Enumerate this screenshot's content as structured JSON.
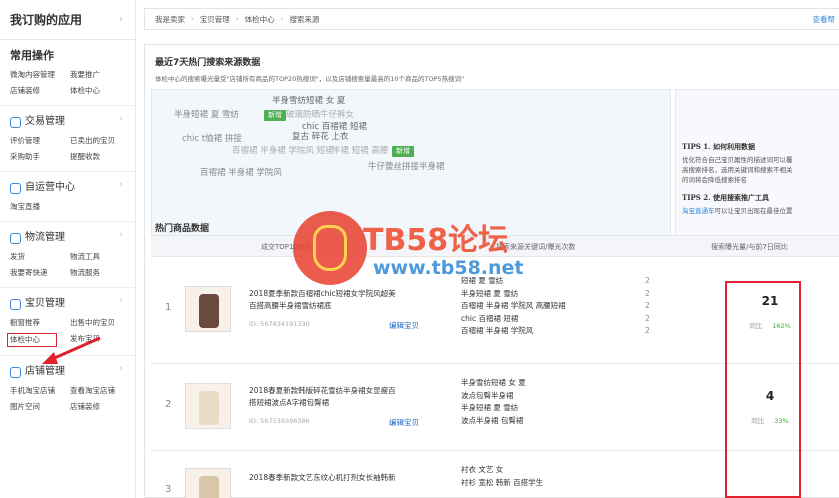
{
  "sidebar": {
    "title": "我订购的应用",
    "common_title": "常用操作",
    "common_links": [
      "微淘内容管理",
      "我要推广",
      "店铺装修",
      "体检中心"
    ],
    "groups": [
      {
        "name": "交易管理",
        "icon": "yen-icon",
        "links": [
          "评价管理",
          "已卖出的宝贝",
          "采购助手",
          "提醒收款"
        ]
      },
      {
        "name": "自运营中心",
        "icon": "chat-icon",
        "links": [
          "淘宝直播"
        ]
      },
      {
        "name": "物流管理",
        "icon": "truck-icon",
        "links": [
          "发货",
          "物流工具",
          "我要寄快递",
          "物流服务"
        ]
      },
      {
        "name": "宝贝管理",
        "icon": "bag-icon",
        "links": [
          "橱窗推荐",
          "出售中的宝贝",
          "体检中心",
          "发布宝贝"
        ]
      },
      {
        "name": "店铺管理",
        "icon": "shop-icon",
        "links": [
          "手机淘宝店铺",
          "查看淘宝店铺",
          "图片空间",
          "店铺装修"
        ]
      }
    ]
  },
  "breadcrumb": [
    "我是卖家",
    "宝贝管理",
    "体检中心",
    "搜索来源"
  ],
  "top_right": "查看帮",
  "section1": {
    "title": "最近7天热门搜索来源数据",
    "desc": "体检中心的搜索曝光量受\"店铺所有商品的TOP20热搜词\"，以及店铺搜索量最高的10个商品的TOP5热搜词\""
  },
  "word_cloud": {
    "words": [
      "半身雪纺短裙 女 夏",
      "半身短裙 夏 雪纺",
      "玻璃防晒牛仔裤女",
      "chic 百褶裙 短裙",
      "chic t恤裙 拼接",
      "复古 碎花 上衣",
      "百褶裙 半身裙 学院风 短裙",
      "半裙 短裙 高腰",
      "百褶裙 半身裙 学院风",
      "牛仔蕾丝拼接半身裙"
    ],
    "tags": [
      "新增",
      "新增"
    ]
  },
  "tips": {
    "tip1_title": "TIPS 1. 如何利用数据",
    "tip1_lines": [
      "优化符合自己宝贝属性的描述词可以覆",
      "高搜索排名，选用关键词和搜索不相关",
      "的词将会降低搜索排名"
    ],
    "tip2_title": "TIPS 2. 使用搜索推广工具",
    "tip2_link": "淘宝直通车",
    "tip2_rest": "可以让宝贝出现在最佳位置"
  },
  "section2": {
    "title": "热门商品数据"
  },
  "table": {
    "headers": [
      "成交TOP10宝贝",
      "搜索来源关键词/曝光次数",
      "搜索曝光量/与前7日同比"
    ],
    "rows": [
      {
        "rank": "1",
        "name1": "2018夏季新款百褶裙chic短裙女学院风超美",
        "name2": "百搭高腰半身裙雪纺裙底",
        "id": "ID: 567834191330",
        "edit": "编辑宝贝",
        "keywords": [
          "短裙 夏 雪纺",
          "半身短裙 夏 雪纺",
          "百褶裙 半身裙 学院风 高腰短裙",
          "chic 百褶裙 短裙",
          "百褶裙 半身裙 学院风"
        ],
        "counts": [
          "2",
          "2",
          "2",
          "2",
          "2"
        ],
        "exposure": "21",
        "compare_label": "同比",
        "compare_value": "162%"
      },
      {
        "rank": "2",
        "name1": "2018春夏新款韩版碎花雪纺半身裙女显瘦百",
        "name2": "搭短裙波点A字裙包臀裙",
        "id": "ID: 567539396386",
        "edit": "编辑宝贝",
        "keywords": [
          "半身雪纺短裙 女 夏",
          "波点包臀半身裙",
          "半身短裙 夏 雪纺",
          "波点半身裙 包臀裙"
        ],
        "counts": [
          "",
          "",
          "",
          ""
        ],
        "exposure": "4",
        "compare_label": "同比",
        "compare_value": "33%"
      },
      {
        "rank": "3",
        "name1": "2018春季新款文艺东纹心机打剂女长袖韩新",
        "name2": "",
        "id": "",
        "edit": "",
        "keywords": [
          "衬衣 文艺 女",
          "衬衫 宽松 韩新 百搭学生"
        ],
        "counts": [],
        "exposure": "",
        "compare_label": "",
        "compare_value": ""
      }
    ]
  },
  "watermark": {
    "title": "TB58论坛",
    "url": "www.tb58.net"
  },
  "colors": {
    "accent_blue": "#3b87d8",
    "highlight_red": "#e0222e",
    "tag_green": "#4caf50"
  }
}
